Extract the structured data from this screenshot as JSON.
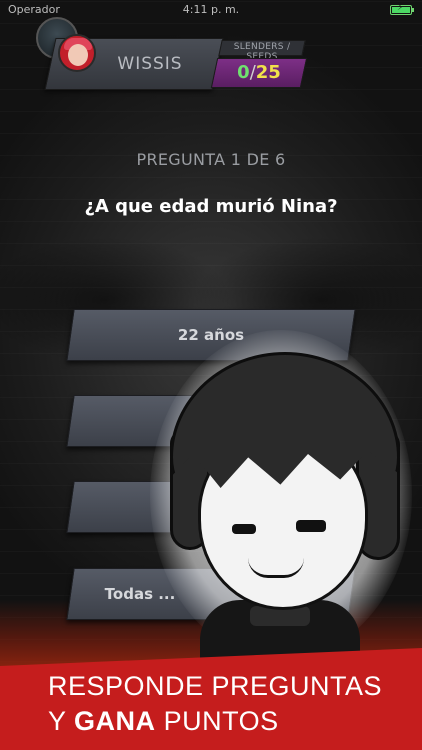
{
  "status_bar": {
    "carrier": "Operador",
    "time": "4:11 p. m."
  },
  "header": {
    "username": "WISSIS",
    "score_label": "SLENDERS / SEEDS",
    "score_current": "0",
    "score_separator": "/",
    "score_total": "25"
  },
  "quiz": {
    "counter": "PREGUNTA 1 DE 6",
    "question": "¿A que edad murió Nina?",
    "answers": [
      {
        "label": "22 años"
      },
      {
        "label": ""
      },
      {
        "label": ""
      },
      {
        "label": "Todas ..."
      }
    ]
  },
  "banner": {
    "line1": "RESPONDE PREGUNTAS",
    "line2_prefix": "Y",
    "line2_bold": "GANA",
    "line2_suffix": "PUNTOS"
  },
  "colors": {
    "score_current": "#6fe06f",
    "score_total": "#f0e24a",
    "score_box": "#7d2f86",
    "banner": "#c51d1d"
  }
}
